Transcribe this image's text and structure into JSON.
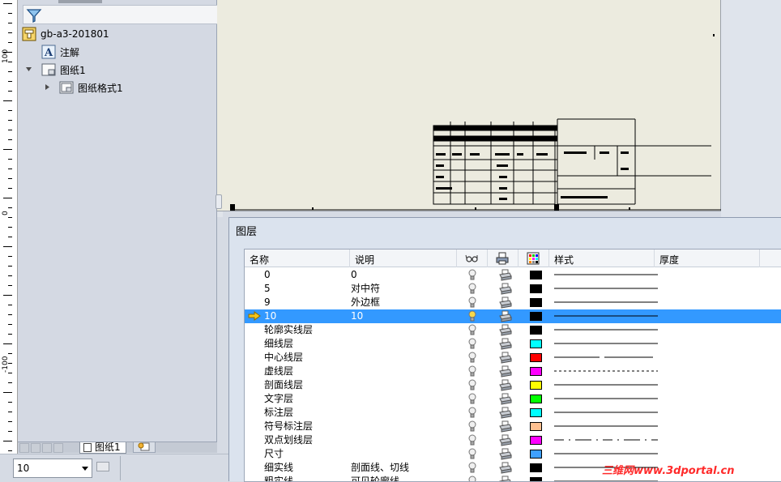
{
  "ruler": {
    "labels": [
      "100",
      "0",
      "-100"
    ]
  },
  "tree": {
    "root_label": "gb-a3-201801",
    "annotation_label": "注解",
    "sheet_label": "图纸1",
    "sheet_format_label": "图纸格式1"
  },
  "tree_tabs": {
    "sheet_tab_label": "图纸1"
  },
  "statusbar": {
    "layer_value": "10"
  },
  "layer_panel": {
    "title": "图层",
    "columns": {
      "name": "名称",
      "desc": "说明",
      "style": "样式",
      "thickness": "厚度"
    },
    "rows": [
      {
        "name": "0",
        "desc": "0",
        "color": "#000000",
        "style": "solid",
        "thick": 1
      },
      {
        "name": "5",
        "desc": "对中符",
        "color": "#000000",
        "style": "solid",
        "thick": 1
      },
      {
        "name": "9",
        "desc": "外边框",
        "color": "#000000",
        "style": "solid",
        "thick": 1
      },
      {
        "name": "10",
        "desc": "10",
        "color": "#000000",
        "style": "solid",
        "thick": 6,
        "selected": true,
        "active_icon": "arrow-icon"
      },
      {
        "name": "轮廓实线层",
        "desc": "",
        "color": "#000000",
        "style": "solid",
        "thick": 3
      },
      {
        "name": "细线层",
        "desc": "",
        "color": "#00ffff",
        "style": "solid",
        "thick": 1
      },
      {
        "name": "中心线层",
        "desc": "",
        "color": "#ff0000",
        "style": "center",
        "thick": 1
      },
      {
        "name": "虚线层",
        "desc": "",
        "color": "#ff00ff",
        "style": "dashed",
        "thick": 1
      },
      {
        "name": "剖面线层",
        "desc": "",
        "color": "#ffff00",
        "style": "solid",
        "thick": 1
      },
      {
        "name": "文字层",
        "desc": "",
        "color": "#00ff00",
        "style": "solid",
        "thick": 1
      },
      {
        "name": "标注层",
        "desc": "",
        "color": "#00ffff",
        "style": "solid",
        "thick": 1
      },
      {
        "name": "符号标注层",
        "desc": "",
        "color": "#ffc090",
        "style": "solid",
        "thick": 1
      },
      {
        "name": "双点划线层",
        "desc": "",
        "color": "#ff00ff",
        "style": "phantom",
        "thick": 1
      },
      {
        "name": "尺寸",
        "desc": "",
        "color": "#3fa0ff",
        "style": "solid",
        "thick": 1
      },
      {
        "name": "细实线",
        "desc": "剖面线、切线",
        "color": "#000000",
        "style": "solid",
        "thick": 1
      },
      {
        "name": "粗实线",
        "desc": "可见轮廓线",
        "color": "#000000",
        "style": "solid",
        "thick": 3
      }
    ]
  },
  "watermark": "三维网www.3dportal.cn"
}
